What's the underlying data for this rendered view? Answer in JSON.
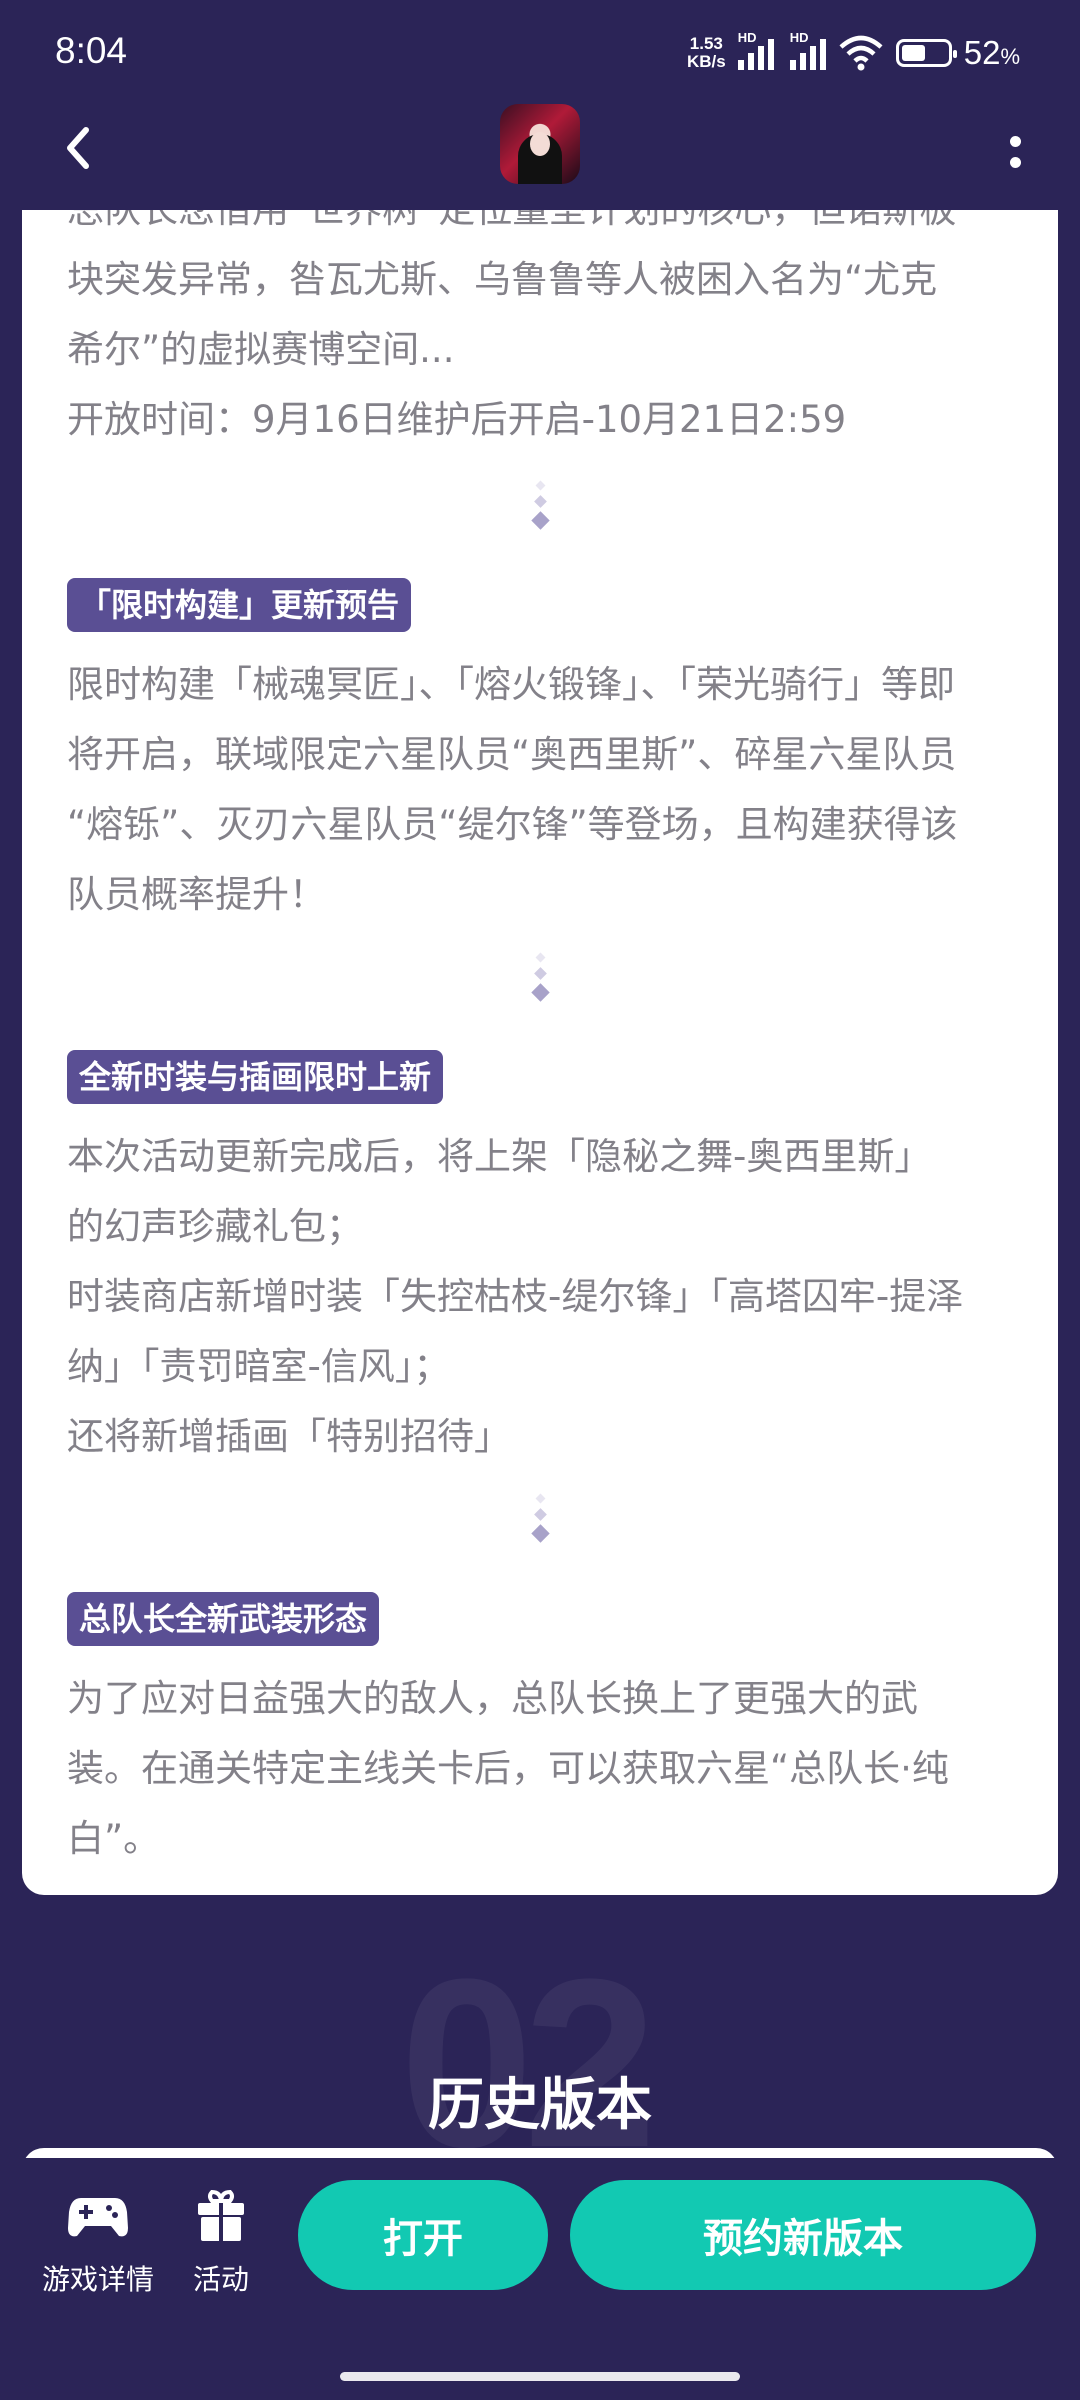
{
  "status_bar": {
    "time": "8:04",
    "net_speed_value": "1.53",
    "net_speed_unit": "KB/s",
    "hd_label_1": "HD",
    "hd_label_2": "HD",
    "battery_percent": "52",
    "battery_percent_sign": "%",
    "battery_level": 0.52
  },
  "header": {
    "back_icon": "chevron-left-icon",
    "more_icon": "more-vertical-icon"
  },
  "article": {
    "intro_lines": [
      "总队长您借用“世界树”定位量坚计划的核心，但诺斯板",
      "块突发异常，咎瓦尤斯、乌鲁鲁等人被困入名为“尤克",
      "希尔”的虚拟赛博空间..."
    ],
    "intro_time": "开放时间：9月16日维护后开启-10月21日2:59",
    "sections": [
      {
        "tag": "「限时构建」更新预告",
        "lines": [
          "限时构建「械魂冥匠」、「熔火锻锋」、「荣光骑行」等即",
          "将开启，联域限定六星队员“奥西里斯”、碎星六星队员",
          "“熔铄”、灭刃六星队员“缇尔锋”等登场，且构建获得该",
          "队员概率提升！"
        ]
      },
      {
        "tag": "全新时装与插画限时上新",
        "lines": [
          "本次活动更新完成后，将上架「隐秘之舞-奥西里斯」",
          "的幻声珍藏礼包；",
          "时装商店新增时装「失控枯枝-缇尔锋」「高塔囚牢-提泽",
          "纳」「责罚暗室-信风」；",
          "还将新增插画「特别招待」"
        ]
      },
      {
        "tag": "总队长全新武装形态",
        "lines": [
          "为了应对日益强大的敌人，总队长换上了更强大的武",
          "装。在通关特定主线关卡后，可以获取六星“总队长·纯",
          "白”。"
        ]
      }
    ]
  },
  "history": {
    "number": "02",
    "title": "历史版本"
  },
  "bottom_bar": {
    "nav_game_details": "游戏详情",
    "nav_activity": "活动",
    "open_button": "打开",
    "reserve_button": "预约新版本"
  },
  "colors": {
    "background": "#2b2457",
    "tag_bg": "#5a4f94",
    "accent_button": "#12c9b2",
    "body_text": "#838189"
  }
}
